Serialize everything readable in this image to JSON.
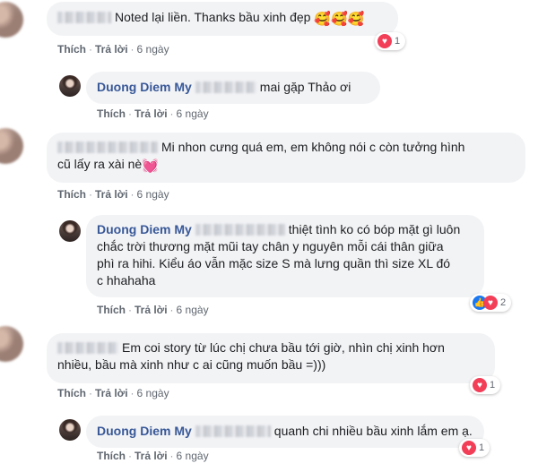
{
  "comments": [
    {
      "text": "Noted lại liền. Thanks bầu xinh đẹp",
      "emoji": "🥰🥰🥰",
      "actions": {
        "like": "Thích",
        "reply": "Trả lời",
        "time": "6 ngày"
      },
      "reactions": {
        "icon": "heart",
        "count": "1"
      },
      "reply": {
        "author": "Duong Diem My",
        "text": "mai gặp Thảo ơi",
        "actions": {
          "like": "Thích",
          "reply": "Trả lời",
          "time": "6 ngày"
        }
      }
    },
    {
      "text_line1": "Mi nhon cưng quá em, em không nói c còn tưởng hình",
      "text_line2": "cũ lấy ra xài nè",
      "emoji": "💓",
      "actions": {
        "like": "Thích",
        "reply": "Trả lời",
        "time": "6 ngày"
      },
      "reply": {
        "author": "Duong Diem My",
        "text_line1": "thiệt tình ko có bóp mặt gì luôn",
        "text_line2": "chắc trời thương mặt mũi tay chân y nguyên mỗi cái thân giữa",
        "text_line3": "phì ra hihi. Kiểu áo vẫn mặc size S mà lưng quần thì size XL đó",
        "text_line4": "c hhahaha",
        "actions": {
          "like": "Thích",
          "reply": "Trả lời",
          "time": "6 ngày"
        },
        "reactions": {
          "icon": "like-heart",
          "count": "2"
        }
      }
    },
    {
      "text_line1": "Em coi story từ lúc chị chưa bầu tới giờ, nhìn chị xinh hơn",
      "text_line2": "nhiều, bầu mà xinh như c ai cũng muốn bầu =)))",
      "actions": {
        "like": "Thích",
        "reply": "Trả lời",
        "time": "6 ngày"
      },
      "reactions": {
        "icon": "heart",
        "count": "1"
      },
      "reply": {
        "author": "Duong Diem My",
        "text": "quanh chi nhiều bầu xinh lắm em ạ.",
        "actions": {
          "like": "Thích",
          "reply": "Trả lời",
          "time": "6 ngày"
        },
        "reactions": {
          "icon": "heart",
          "count": "1"
        }
      }
    }
  ],
  "colors": {
    "name": "#385898",
    "bubble": "#f2f3f5",
    "meta": "#606770",
    "heart": "#f33e58",
    "like": "#1877f2"
  }
}
